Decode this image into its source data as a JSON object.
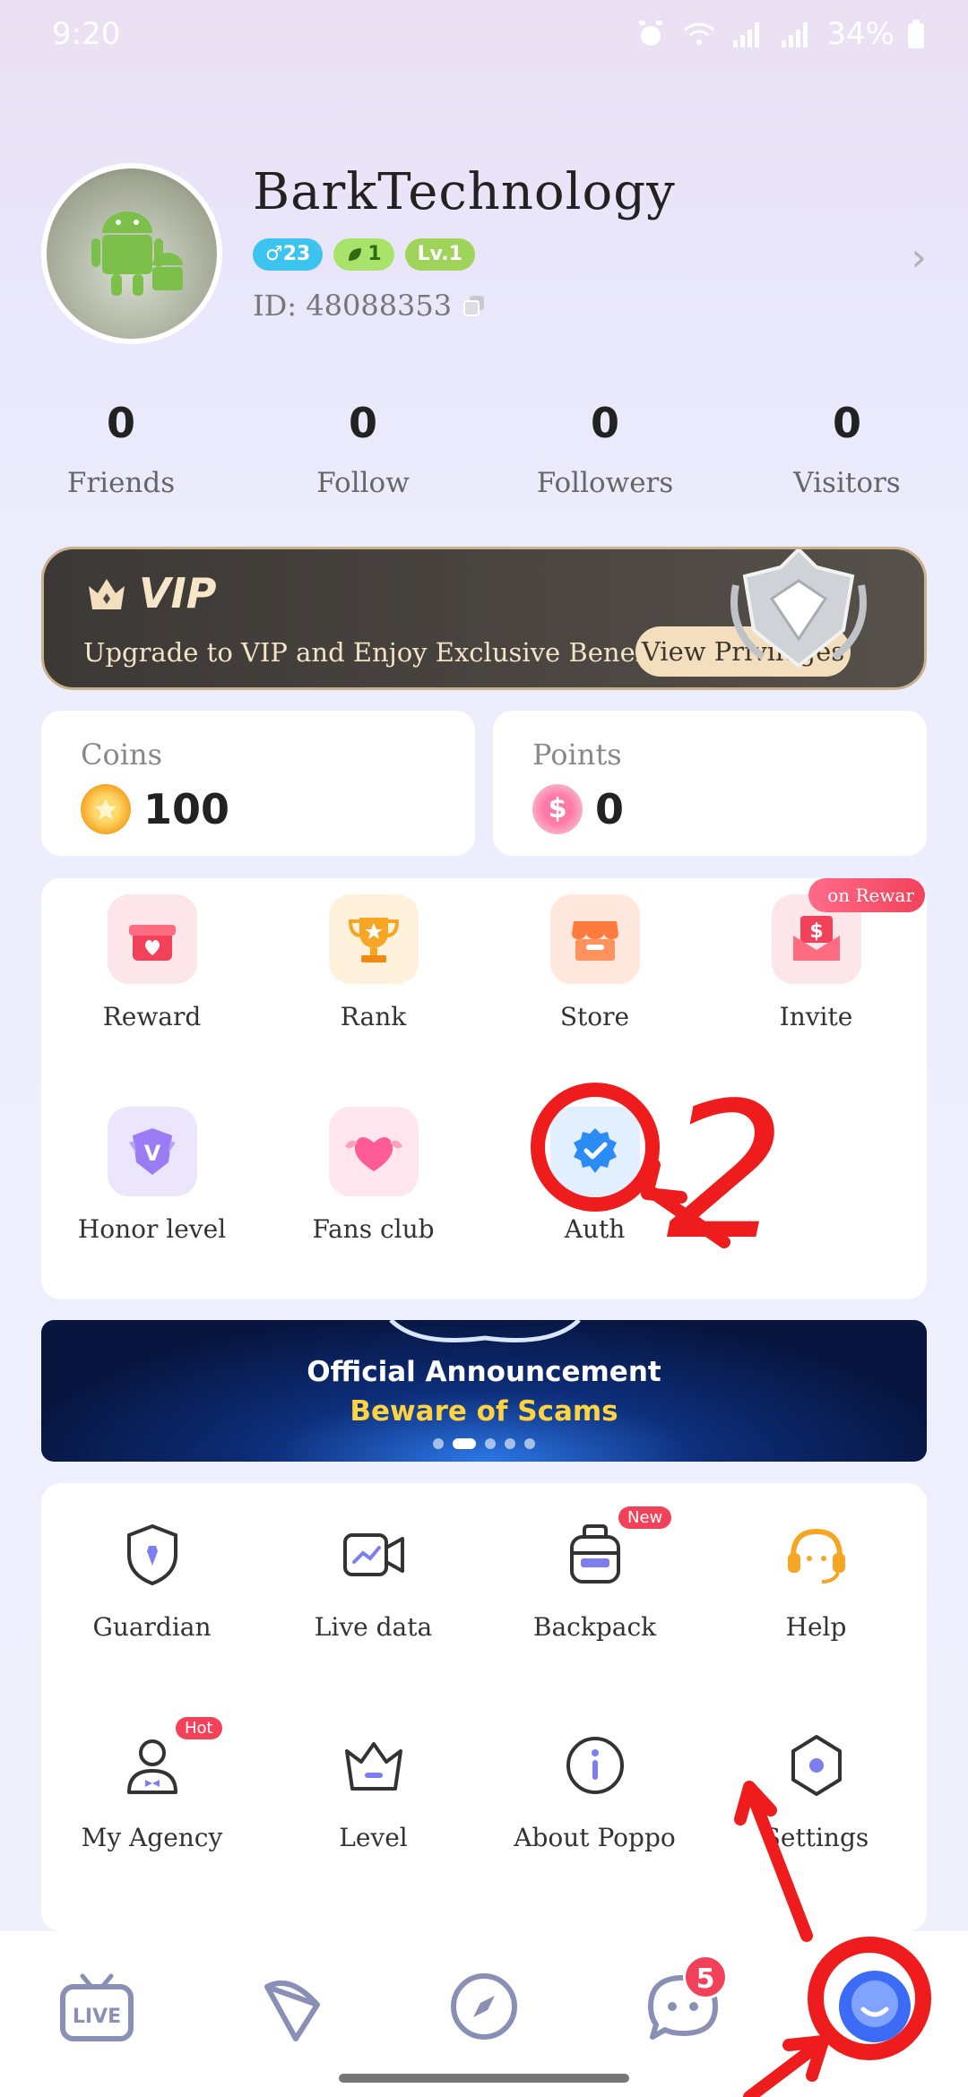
{
  "status_bar": {
    "time": "9:20",
    "battery": "34%"
  },
  "profile": {
    "username": "BarkTechnology",
    "badges": {
      "gender_age": "♂23",
      "leaf": "1",
      "level": "Lv.1"
    },
    "id_text": "ID: 48088353"
  },
  "stats": [
    {
      "value": "0",
      "label": "Friends"
    },
    {
      "value": "0",
      "label": "Follow"
    },
    {
      "value": "0",
      "label": "Followers"
    },
    {
      "value": "0",
      "label": "Visitors"
    }
  ],
  "vip": {
    "title": "VIP",
    "subtitle": "Upgrade to VIP and Enjoy Exclusive Benefits",
    "button": "View Privileges"
  },
  "wallet": {
    "coins": {
      "label": "Coins",
      "value": "100"
    },
    "points": {
      "label": "Points",
      "value": "0"
    }
  },
  "features": [
    {
      "label": "Reward",
      "icon": "gift-icon"
    },
    {
      "label": "Rank",
      "icon": "trophy-icon"
    },
    {
      "label": "Store",
      "icon": "store-icon"
    },
    {
      "label": "Invite",
      "icon": "invite-icon",
      "ribbon": "on   Rewar"
    },
    {
      "label": "Honor level",
      "icon": "honor-shield-icon"
    },
    {
      "label": "Fans club",
      "icon": "heart-wings-icon"
    },
    {
      "label": "Auth",
      "icon": "verified-badge-icon"
    }
  ],
  "banner": {
    "title": "Official Announcement",
    "subtitle": "Beware of Scams",
    "active_slide": 2,
    "slide_count": 5
  },
  "tools": [
    {
      "label": "Guardian",
      "icon": "guardian-shield-icon"
    },
    {
      "label": "Live data",
      "icon": "live-data-icon"
    },
    {
      "label": "Backpack",
      "icon": "backpack-icon",
      "tag": "New"
    },
    {
      "label": "Help",
      "icon": "headset-icon"
    },
    {
      "label": "My Agency",
      "icon": "agency-icon",
      "tag": "Hot"
    },
    {
      "label": "Level",
      "icon": "crown-icon"
    },
    {
      "label": "About Poppo",
      "icon": "info-icon"
    },
    {
      "label": "Settings",
      "icon": "settings-hex-icon"
    }
  ],
  "bottom_nav": {
    "live_label": "LIVE",
    "messages_badge": "5"
  },
  "annotation": {
    "number": "2"
  },
  "colors": {
    "accent_red": "#f2425a",
    "nav_icon": "#8a8fb5",
    "profile_active": "#3c6cf5"
  }
}
